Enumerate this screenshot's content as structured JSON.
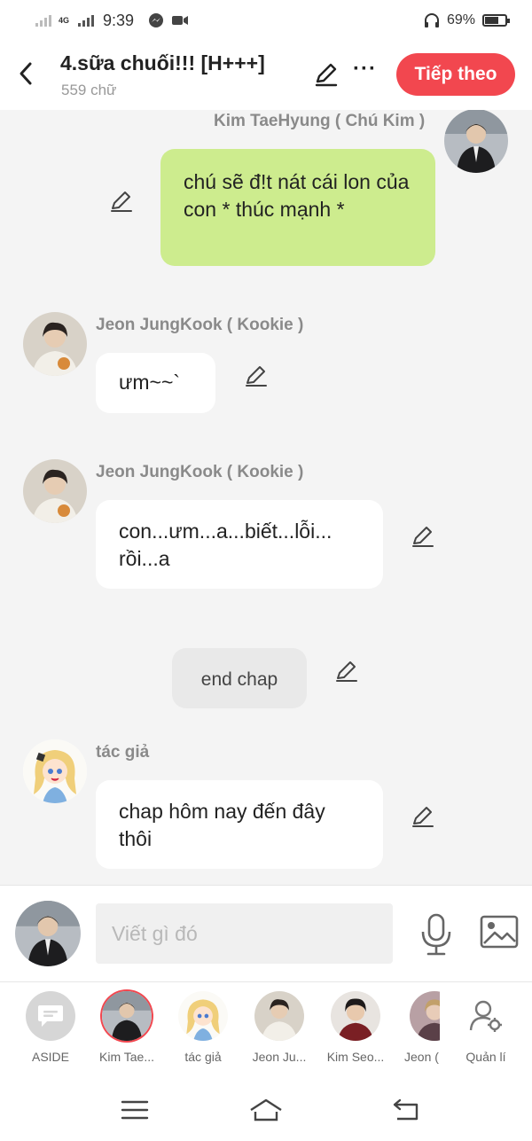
{
  "status_bar": {
    "network": "4G",
    "time": "9:39",
    "battery": "69%",
    "battery_level": 0.69,
    "icons": [
      "signal-icon",
      "messenger-icon",
      "video-icon",
      "headphones-icon",
      "battery-icon"
    ]
  },
  "header": {
    "title": "4.sữa chuối!!! [H+++]",
    "subtitle": "559 chữ",
    "next_label": "Tiếp theo",
    "more_label": "···"
  },
  "messages": [
    {
      "sender": "Kim TaeHyung ( Chú Kim )",
      "text": "chú sẽ đ!t nát cái lon của con * thúc mạnh *",
      "side": "right"
    },
    {
      "sender": "Jeon JungKook ( Kookie )",
      "text": "ưm~~`",
      "side": "left"
    },
    {
      "sender": "Jeon JungKook ( Kookie )",
      "text": "con...ưm...a...biết...lỗi... rồi...a",
      "side": "left"
    },
    {
      "sender": "",
      "text": "end chap",
      "side": "center"
    },
    {
      "sender": "tác giả",
      "text": "chap hôm nay đến đây thôi",
      "side": "left"
    }
  ],
  "composer": {
    "placeholder": "Viết gì đó"
  },
  "characters": [
    {
      "label": "ASIDE"
    },
    {
      "label": "Kim Tae..."
    },
    {
      "label": "tác giả"
    },
    {
      "label": "Jeon Ju..."
    },
    {
      "label": "Kim Seo..."
    },
    {
      "label": "Jeon ("
    },
    {
      "label": "Quản lí"
    }
  ],
  "colors": {
    "accent": "#f2474f",
    "bubble_right": "#cdec8e",
    "bubble_left": "#ffffff",
    "background": "#f4f4f4"
  }
}
